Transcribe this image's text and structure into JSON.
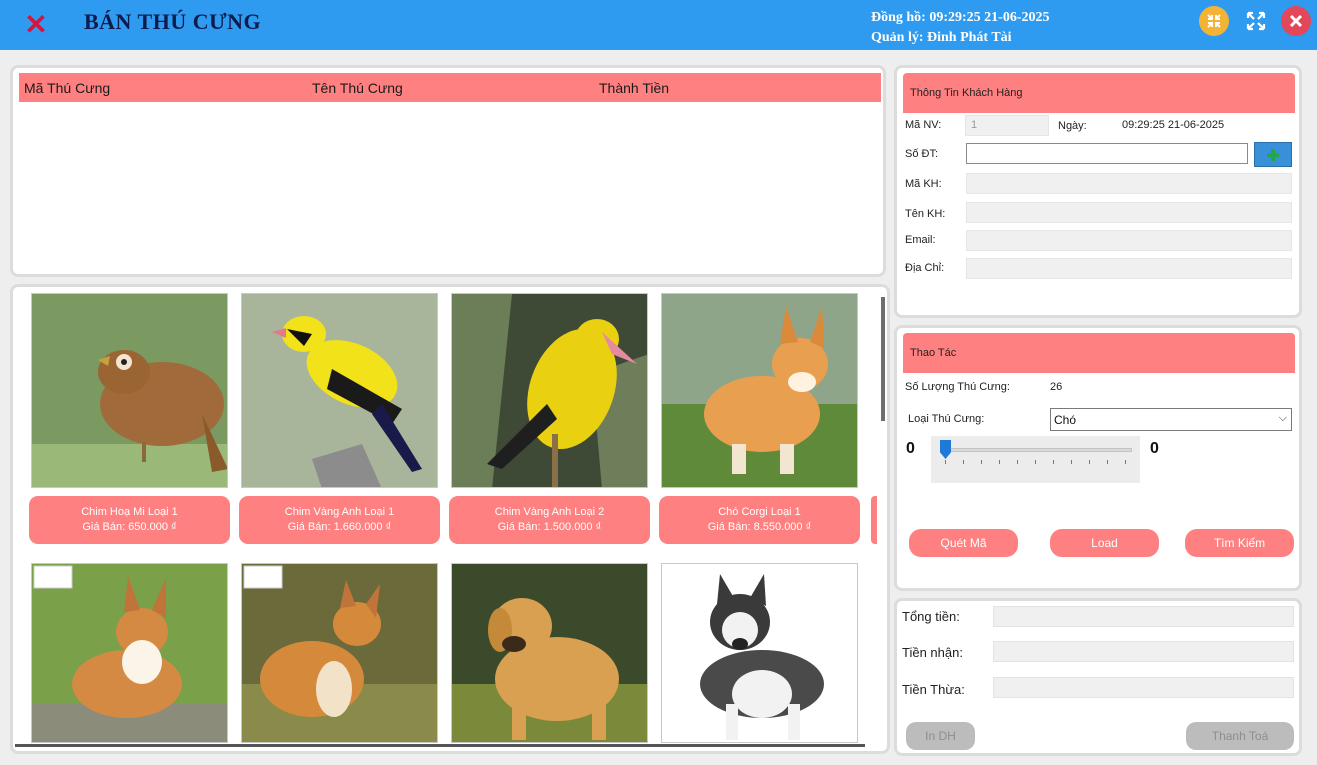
{
  "window": {
    "title": "BÁN THÚ CƯNG",
    "clock_line": "Đồng hồ: 09:29:25 21-06-2025",
    "manager_line": "Quản lý: Đinh Phát Tài"
  },
  "cart": {
    "columns": [
      "Mã Thú Cưng",
      "Tên Thú Cưng",
      "Thành Tiền"
    ]
  },
  "products": [
    {
      "name": "Chim Hoạ Mi Loại 1",
      "price": "Giá Bán: 650.000 ₫",
      "icon": "bird-photo"
    },
    {
      "name": "Chim Vàng Anh Loại 1",
      "price": "Giá Bán: 1.660.000 ₫",
      "icon": "bird-photo"
    },
    {
      "name": "Chim Vàng Anh Loại 2",
      "price": "Giá Bán: 1.500.000 ₫",
      "icon": "bird-photo"
    },
    {
      "name": "Chó Corgi Loại 1",
      "price": "Giá Bán: 8.550.000 ₫",
      "icon": "dog-photo"
    },
    {
      "icon": "dog-photo"
    },
    {
      "icon": "dog-photo"
    },
    {
      "icon": "dog-photo"
    },
    {
      "icon": "dog-photo"
    }
  ],
  "customer": {
    "header": "Thông Tin Khách Hàng",
    "ma_nv_label": "Mã NV:",
    "ma_nv_value": "1",
    "date_label": "Ngày:",
    "date_value": "09:29:25 21-06-2025",
    "phone_label": "Số ĐT:",
    "phone_value": "",
    "ma_kh_label": "Mã KH:",
    "ten_kh_label": "Tên KH:",
    "email_label": "Email:",
    "address_label": "Địa Chỉ:"
  },
  "ops": {
    "header": "Thao Tác",
    "count_label": "Số Lượng Thú Cưng:",
    "count_value": "26",
    "type_label": "Loại Thú Cưng:",
    "type_value": "Chó",
    "slider_min_readout": "0",
    "slider_max_readout": "0",
    "slider_level": 0,
    "scan_button": "Quét Mã",
    "load_button": "Load",
    "search_button": "Tìm Kiếm"
  },
  "payment": {
    "total_label": "Tổng tiền:",
    "received_label": "Tiền nhận:",
    "change_label": "Tiền Thừa:",
    "print_button": "In DH",
    "pay_button": "Thanh Toá"
  },
  "colors": {
    "titlebar": "#2f9bf0",
    "accent_pink": "#ff8080",
    "close_red": "#d6143c"
  }
}
